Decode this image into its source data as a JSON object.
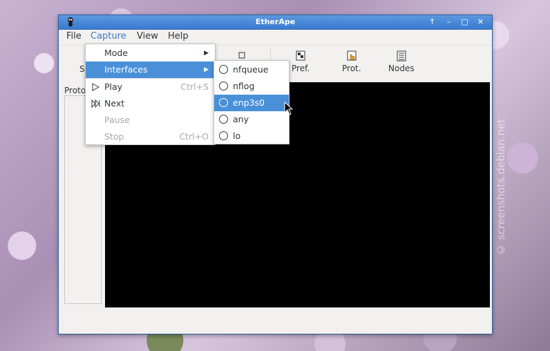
{
  "desktop": {
    "watermark": "© screenshots.debian.net"
  },
  "window": {
    "title": "EtherApe",
    "buttons": {
      "up": "↑",
      "minimize": "–",
      "maximize": "□",
      "close": "✕"
    }
  },
  "menubar": {
    "items": [
      "File",
      "Capture",
      "View",
      "Help"
    ],
    "active": "Capture"
  },
  "toolbar": {
    "start_label": "St",
    "pref_label": "Pref.",
    "prot_label": "Prot.",
    "nodes_label": "Nodes"
  },
  "sidebar": {
    "label": "Proto"
  },
  "capture_menu": {
    "items": [
      {
        "label": "Mode",
        "submenu": true
      },
      {
        "label": "Interfaces",
        "submenu": true,
        "highlighted": true
      },
      {
        "label": "Play",
        "accel": "Ctrl+S",
        "icon": "play-icon"
      },
      {
        "label": "Next",
        "icon": "next-icon"
      },
      {
        "label": "Pause",
        "disabled": true
      },
      {
        "label": "Stop",
        "accel": "Ctrl+O",
        "disabled": true
      }
    ]
  },
  "interfaces_menu": {
    "items": [
      "nfqueue",
      "nflog",
      "enp3s0",
      "any",
      "lo"
    ],
    "highlighted": "enp3s0"
  },
  "colors": {
    "accent": "#4a90d9",
    "titlebar": "#3a7bd0",
    "canvas": "#000000"
  }
}
